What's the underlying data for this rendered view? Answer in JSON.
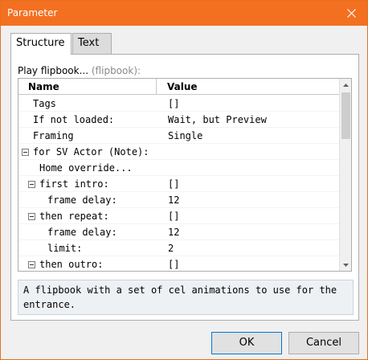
{
  "window": {
    "title": "Parameter"
  },
  "tabs": [
    {
      "label": "Structure",
      "active": true
    },
    {
      "label": "Text",
      "active": false
    }
  ],
  "section": {
    "label": "Play flipbook...",
    "id_label": "(flipbook):"
  },
  "grid": {
    "columns": [
      "Name",
      "Value"
    ],
    "rows": [
      {
        "name": "Tags",
        "value": "[]",
        "indent": 1,
        "expander": false
      },
      {
        "name": "If not loaded:",
        "value": "Wait, but Preview",
        "indent": 1,
        "expander": false
      },
      {
        "name": "Framing",
        "value": "Single",
        "indent": 1,
        "expander": false
      },
      {
        "name": "for SV Actor (Note):",
        "value": "",
        "indent": 0,
        "expander": true
      },
      {
        "name": "Home override...",
        "value": "",
        "indent": 2,
        "expander": false
      },
      {
        "name": "first intro:",
        "value": "[]",
        "indent": 1,
        "expander": true
      },
      {
        "name": "frame delay:",
        "value": "12",
        "indent": 3,
        "expander": false
      },
      {
        "name": "then repeat:",
        "value": "[]",
        "indent": 1,
        "expander": true
      },
      {
        "name": "frame delay:",
        "value": "12",
        "indent": 3,
        "expander": false
      },
      {
        "name": "limit:",
        "value": "2",
        "indent": 3,
        "expander": false
      },
      {
        "name": "then outro:",
        "value": "[]",
        "indent": 1,
        "expander": true
      }
    ]
  },
  "description": "A flipbook with a set of cel animations to use for the entrance.",
  "buttons": {
    "ok": "OK",
    "cancel": "Cancel"
  },
  "colors": {
    "titlebar": "#f37021",
    "accent": "#0078d7"
  },
  "icons": {
    "close": "close-icon",
    "expander": "collapse-icon",
    "scroll_up": "scroll-up-arrow-icon",
    "scroll_down": "scroll-down-arrow-icon"
  }
}
